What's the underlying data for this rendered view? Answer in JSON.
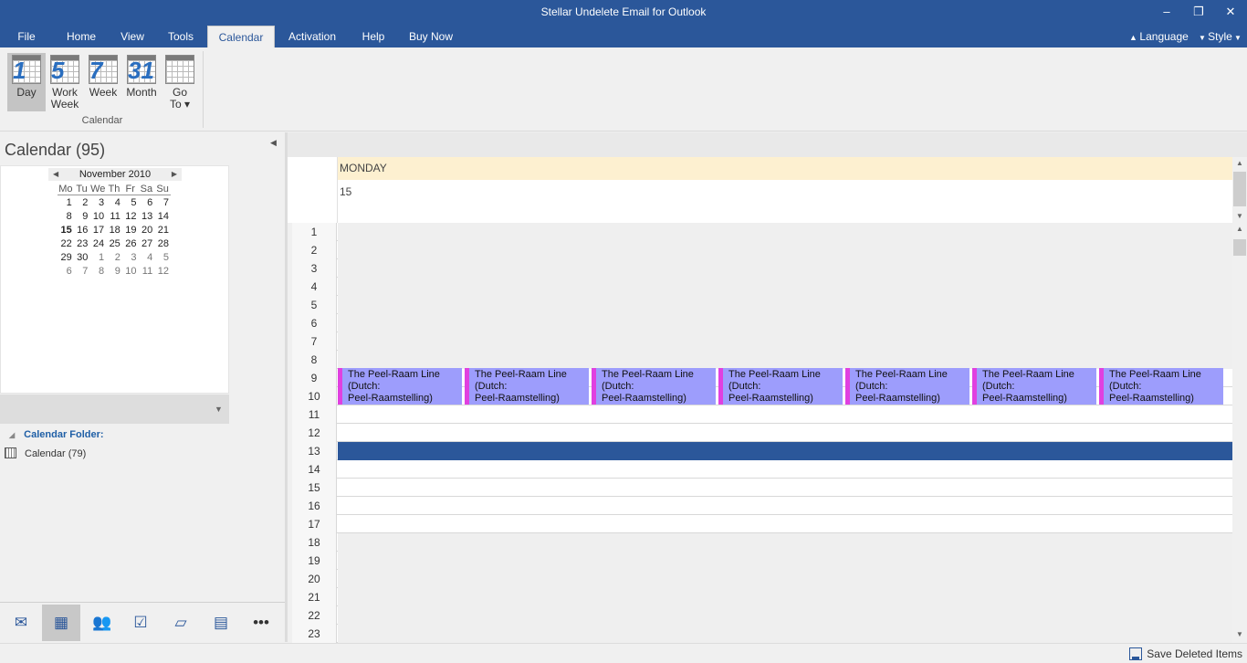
{
  "window": {
    "title": "Stellar Undelete Email for Outlook"
  },
  "menu": {
    "items": [
      "File",
      "Home",
      "View",
      "Tools",
      "Calendar",
      "Activation",
      "Help",
      "Buy Now"
    ],
    "active": "Calendar",
    "language": "Language",
    "style": "Style"
  },
  "ribbon": {
    "buttons": [
      {
        "num": "1",
        "label1": "Day",
        "label2": ""
      },
      {
        "num": "5",
        "label1": "Work",
        "label2": "Week"
      },
      {
        "num": "7",
        "label1": "Week",
        "label2": ""
      },
      {
        "num": "31",
        "label1": "Month",
        "label2": ""
      },
      {
        "num": "",
        "label1": "Go",
        "label2": "To ▾"
      }
    ],
    "group_label": "Calendar"
  },
  "left": {
    "title": "Calendar (95)",
    "mini_calendar": {
      "month": "November 2010",
      "weekdays": [
        "Mo",
        "Tu",
        "We",
        "Th",
        "Fr",
        "Sa",
        "Su"
      ],
      "weeks": [
        [
          "1",
          "2",
          "3",
          "4",
          "5",
          "6",
          "7"
        ],
        [
          "8",
          "9",
          "10",
          "11",
          "12",
          "13",
          "14"
        ],
        [
          "15",
          "16",
          "17",
          "18",
          "19",
          "20",
          "21"
        ],
        [
          "22",
          "23",
          "24",
          "25",
          "26",
          "27",
          "28"
        ],
        [
          "29",
          "30",
          "1",
          "2",
          "3",
          "4",
          "5"
        ],
        [
          "6",
          "7",
          "8",
          "9",
          "10",
          "11",
          "12"
        ]
      ],
      "today": "15"
    },
    "folder_header": "Calendar Folder:",
    "folder_item": "Calendar (79)"
  },
  "nav_icons": [
    "mail-icon",
    "calendar-icon",
    "contacts-icon",
    "tasks-icon",
    "notes-icon",
    "journal-icon",
    "more-icon"
  ],
  "calendar": {
    "day_name": "MONDAY",
    "day_number": "15",
    "hours": [
      "1",
      "2",
      "3",
      "4",
      "5",
      "6",
      "7",
      "8",
      "9",
      "10",
      "11",
      "12",
      "13",
      "14",
      "15",
      "16",
      "17",
      "18",
      "19",
      "20",
      "21",
      "22",
      "23"
    ],
    "selected_hour": "13",
    "event": {
      "line1": "The Peel-Raam Line",
      "line2": "(Dutch:",
      "line3": "Peel-Raamstelling)"
    },
    "event_count": 7
  },
  "status": {
    "save_label": "Save Deleted Items"
  },
  "colors": {
    "accent": "#2b579a",
    "event_fill": "#9d9dfc",
    "event_border": "#e040e0",
    "day_header": "#fdf0d0"
  }
}
